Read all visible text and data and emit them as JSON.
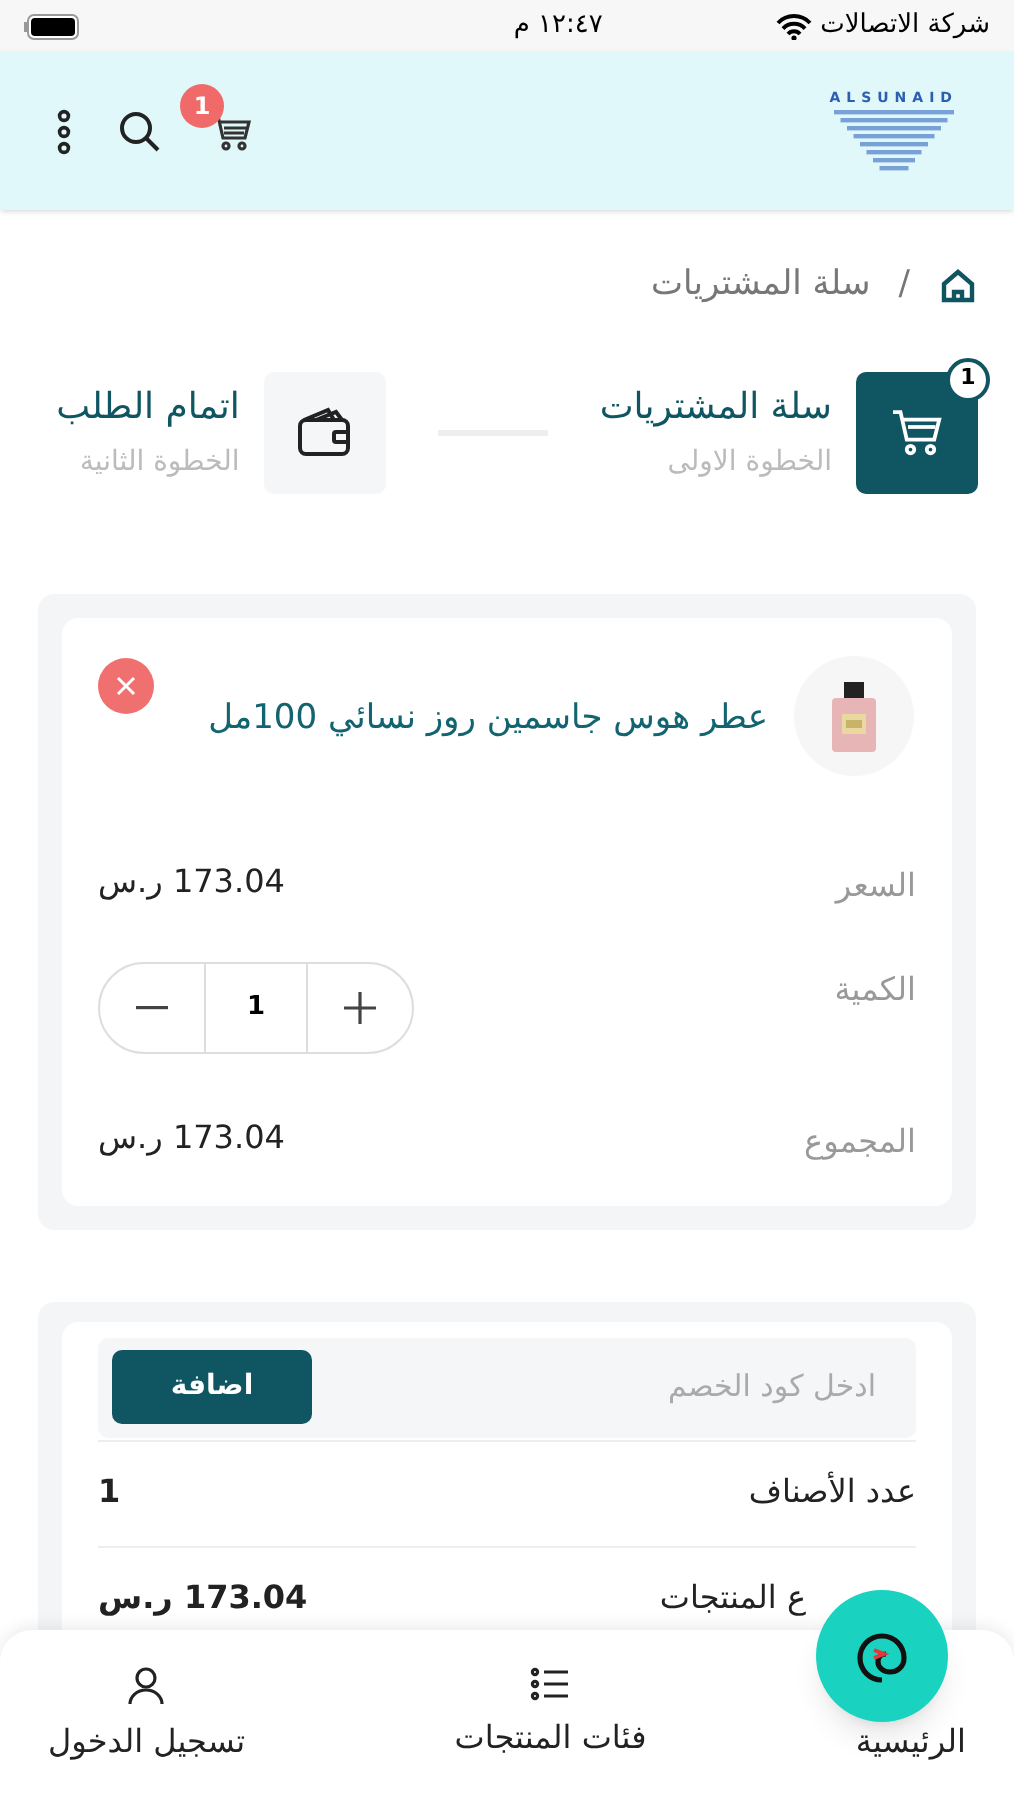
{
  "status_bar": {
    "carrier": "شركة الاتصالات",
    "time": "١٢:٤٧ م"
  },
  "header": {
    "logo": "ALSUNAID",
    "cart_count": "1"
  },
  "breadcrumb": {
    "current": "سلة المشتريات",
    "separator": "/"
  },
  "steps": [
    {
      "title": "سلة المشتريات",
      "subtitle": "الخطوة الاولى",
      "badge": "1",
      "selected": true,
      "kind": "cart"
    },
    {
      "title": "اتمام الطلب",
      "subtitle": "الخطوة الثانية",
      "selected": false,
      "kind": "wallet"
    }
  ],
  "cart_item": {
    "name": "عطر هوس جاسمين روز نسائي 100مل",
    "rows": [
      {
        "label": "السعر",
        "value": "173.04 ر.س",
        "kind": "text"
      },
      {
        "label": "الكمية",
        "value": "1",
        "kind": "stepper"
      },
      {
        "label": "المجموع",
        "value": "173.04 ر.س",
        "kind": "text"
      }
    ]
  },
  "summary": {
    "coupon_placeholder": "ادخل كود الخصم",
    "apply_button": "اضافة",
    "rows": [
      {
        "label": "عدد الأصناف",
        "value": "1"
      },
      {
        "label": "ع المنتجات",
        "value": "173.04 ر.س"
      }
    ]
  },
  "bottom_nav": [
    {
      "label": "الرئيسية",
      "kind": "home"
    },
    {
      "label": "فئات المنتجات",
      "kind": "list"
    },
    {
      "label": "تسجيل الدخول",
      "kind": "user"
    }
  ]
}
